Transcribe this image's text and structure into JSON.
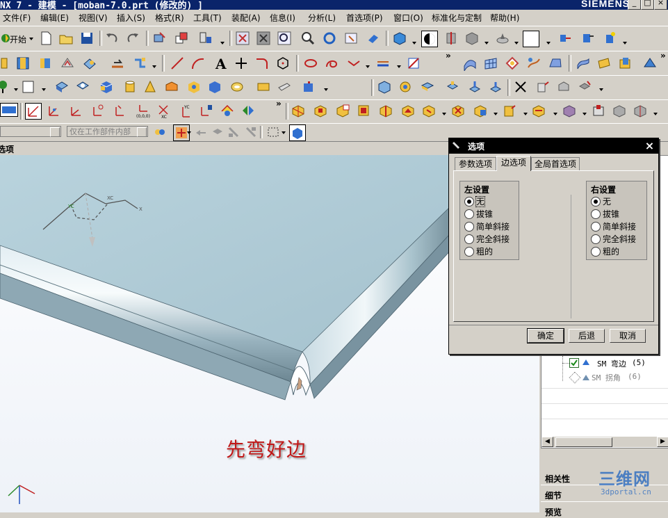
{
  "window": {
    "title": "NX 7 - 建模 - [moban-7.0.prt (修改的) ]",
    "brand": "SIEMENS",
    "controls": [
      "_",
      "□",
      "×"
    ]
  },
  "menubar": {
    "items": [
      "文件(F)",
      "编辑(E)",
      "视图(V)",
      "插入(S)",
      "格式(R)",
      "工具(T)",
      "装配(A)",
      "信息(I)",
      "分析(L)",
      "首选项(P)",
      "窗口(O)",
      "标准化与定制",
      "帮助(H)"
    ]
  },
  "toolbar": {
    "start_label": "开始",
    "filter_placeholder": "仅在工作部件内部"
  },
  "navigator": {
    "title": "选项"
  },
  "viewport": {
    "annotation": "先弯好边",
    "axis_labels": {
      "xc": "XC",
      "yc": "YC",
      "x": "X",
      "zc": "ZC"
    }
  },
  "part_navigator": {
    "items": [
      {
        "label": "SM 弯边",
        "index": "(5)",
        "checked": true
      },
      {
        "label": "SM 拐角",
        "index": "(6)",
        "checked": false
      }
    ],
    "sections": [
      "相关性",
      "细节",
      "预览"
    ]
  },
  "dialog": {
    "title": "选项",
    "tabs": [
      "参数选项",
      "边选项",
      "全局首选项"
    ],
    "active_tab": "边选项",
    "left": {
      "title": "左设置",
      "options": [
        "无",
        "拔锥",
        "简单斜接",
        "完全斜接",
        "粗的"
      ],
      "selected": "无"
    },
    "right": {
      "title": "右设置",
      "options": [
        "无",
        "拔锥",
        "简单斜接",
        "完全斜接",
        "粗的"
      ],
      "selected": "无"
    },
    "buttons": {
      "ok": "确定",
      "back": "后退",
      "cancel": "取消"
    }
  },
  "watermark": {
    "text": "三维网",
    "url": "3dportal.cn"
  },
  "colors": {
    "title_bar": "#0a246a",
    "dialog_title": "#000000",
    "annotation": "#c01818",
    "part": "#8fb0c0"
  }
}
